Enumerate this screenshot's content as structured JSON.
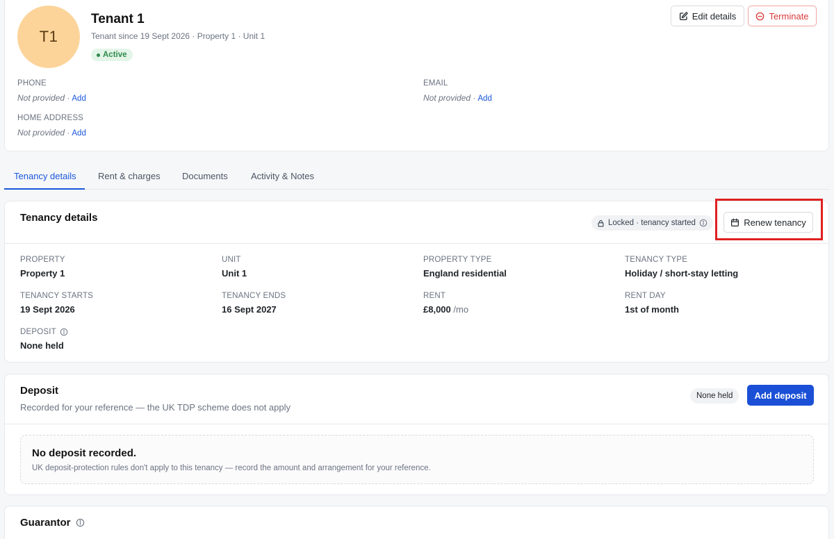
{
  "tenant": {
    "avatar_initials": "T1",
    "name": "Tenant 1",
    "subtitle": "Tenant since 19 Sept 2026 · Property 1 · Unit 1",
    "status": "Active"
  },
  "header_actions": {
    "edit_label": "Edit details",
    "terminate_label": "Terminate"
  },
  "contact": {
    "phone_label": "PHONE",
    "phone_value": "Not provided ·",
    "email_label": "EMAIL",
    "email_value": "Not provided ·",
    "address_label": "HOME ADDRESS",
    "address_value": "Not provided ·",
    "add_label": "Add"
  },
  "tabs": [
    {
      "label": "Tenancy details",
      "active": true
    },
    {
      "label": "Rent & charges",
      "active": false
    },
    {
      "label": "Documents",
      "active": false
    },
    {
      "label": "Activity & Notes",
      "active": false
    }
  ],
  "tenancy": {
    "title": "Tenancy details",
    "locked_label": "Locked · tenancy started",
    "renew_label": "Renew tenancy",
    "fields": {
      "property_label": "PROPERTY",
      "property_value": "Property 1",
      "unit_label": "UNIT",
      "unit_value": "Unit 1",
      "property_type_label": "PROPERTY TYPE",
      "property_type_value": "England residential",
      "tenancy_type_label": "TENANCY TYPE",
      "tenancy_type_value": "Holiday / short-stay letting",
      "starts_label": "TENANCY STARTS",
      "starts_value": "19 Sept 2026",
      "ends_label": "TENANCY ENDS",
      "ends_value": "16 Sept 2027",
      "rent_label": "RENT",
      "rent_value": "£8,000",
      "rent_unit": "/mo",
      "rent_day_label": "RENT DAY",
      "rent_day_value": "1st of month",
      "deposit_label": "DEPOSIT",
      "deposit_value": "None held"
    }
  },
  "deposit": {
    "title": "Deposit",
    "subtitle": "Recorded for your reference — the UK TDP scheme does not apply",
    "status_chip": "None held",
    "add_label": "Add deposit",
    "empty_title": "No deposit recorded.",
    "empty_desc": "UK deposit-protection rules don't apply to this tenancy — record the amount and arrangement for your reference."
  },
  "guarantor": {
    "title": "Guarantor"
  },
  "colors": {
    "accent": "#1a56db",
    "danger": "#d93a3a",
    "success": "#2e8a4a",
    "avatar_bg": "#fcd49a",
    "highlight": "#e02020"
  }
}
